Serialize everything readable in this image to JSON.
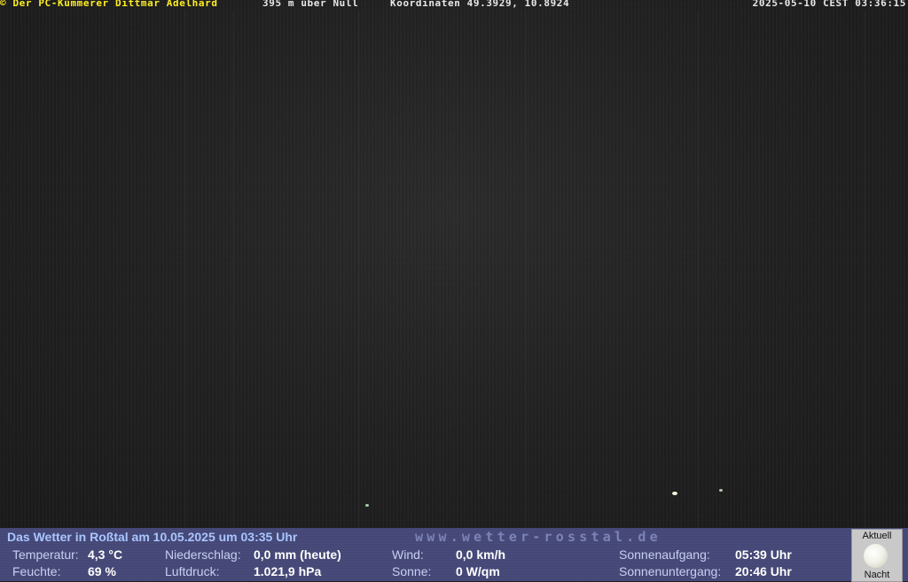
{
  "overlay": {
    "copyright": "© Der PC-Kümmerer Dittmar Adelhard",
    "altitude": "395 m über Null",
    "coordinates": "Koordinaten 49.3929, 10.8924",
    "datetime": "2025-05-10 CEST 03:36:15"
  },
  "weather": {
    "title": "Das Wetter in Roßtal am 10.05.2025 um 03:35 Uhr",
    "url": "www.wetter-rosstal.de",
    "temperature": {
      "label": "Temperatur:",
      "value": "4,3 °C"
    },
    "humidity": {
      "label": "Feuchte:",
      "value": "69 %"
    },
    "precipitation": {
      "label": "Niederschlag:",
      "value": "0,0 mm (heute)"
    },
    "pressure": {
      "label": "Luftdruck:",
      "value": "1.021,9 hPa"
    },
    "wind": {
      "label": "Wind:",
      "value": "0,0 km/h"
    },
    "sun": {
      "label": "Sonne:",
      "value": "0 W/qm"
    },
    "sunrise": {
      "label": "Sonnenaufgang:",
      "value": "05:39 Uhr"
    },
    "sunset": {
      "label": "Sonnenuntergang:",
      "value": "20:46 Uhr"
    }
  },
  "moon": {
    "top_label": "Aktuell",
    "bottom_label": "Nacht",
    "icon": "moon-icon"
  }
}
